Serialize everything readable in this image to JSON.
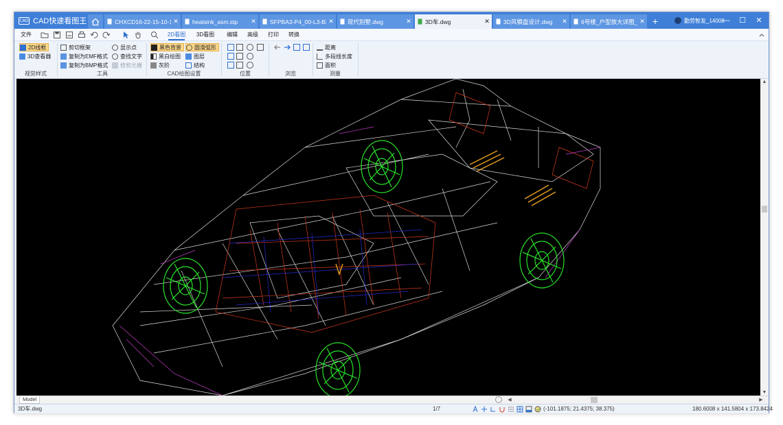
{
  "app": {
    "title": "CAD快速看图王",
    "logo_text": "CAD"
  },
  "tabs": [
    {
      "label": "CHXCD16-22-15-10-1...",
      "active": false
    },
    {
      "label": "heatsink_asm.stp",
      "active": false
    },
    {
      "label": "SFPBA3-P4_00-L3-B3.i...",
      "active": false
    },
    {
      "label": "现代别墅.dwg",
      "active": false
    },
    {
      "label": "3D车.dwg",
      "active": true
    },
    {
      "label": "3D风犋盘设计.dwg",
      "active": false
    },
    {
      "label": "6号楼_户型放大详图_t8...",
      "active": false
    }
  ],
  "user": {
    "name": "勤劳智友_14008"
  },
  "menu": [
    {
      "label": "文件",
      "active": false
    },
    {
      "label": "2D看图",
      "active": true
    },
    {
      "label": "3D看图",
      "active": false
    },
    {
      "label": "编辑",
      "active": false
    },
    {
      "label": "高级",
      "active": false
    },
    {
      "label": "打印",
      "active": false
    },
    {
      "label": "转换",
      "active": false
    }
  ],
  "ribbon": {
    "visual_style": {
      "label": "视觉样式",
      "items": [
        "2D线框",
        "3D查看器"
      ]
    },
    "tools": {
      "label": "工具",
      "items": [
        "剪切框架",
        "复制为EMF格式",
        "复制为BMP格式",
        "显示点",
        "查找文字",
        "修剪光栅"
      ]
    },
    "draw_settings": {
      "label": "CAD绘图设置",
      "items": [
        "黑色背景",
        "黑白绘图",
        "灰阶",
        "圆滑弧形",
        "图层",
        "结构"
      ]
    },
    "position": {
      "label": "位置"
    },
    "browse": {
      "label": "浏览"
    },
    "measure": {
      "label": "测量",
      "items": [
        "距离",
        "多段线长度",
        "面积"
      ]
    }
  },
  "viewport": {
    "background": "#000000",
    "model_tab": "Model"
  },
  "status": {
    "filename": "3D车.dwg",
    "page": "1/7",
    "coordinates": "(-101.1875; 21.4375; 38.375)",
    "dimensions": "180.6008 x 141.5804 x 173.8424"
  },
  "colors": {
    "titlebar": "#3f7fd8",
    "accent": "#2e6fd1",
    "wheel": "#29e529",
    "body_red": "#d33a1e",
    "interior_blue": "#2a2ad8",
    "trim_magenta": "#c03cc8",
    "detail_orange": "#e8a020"
  }
}
